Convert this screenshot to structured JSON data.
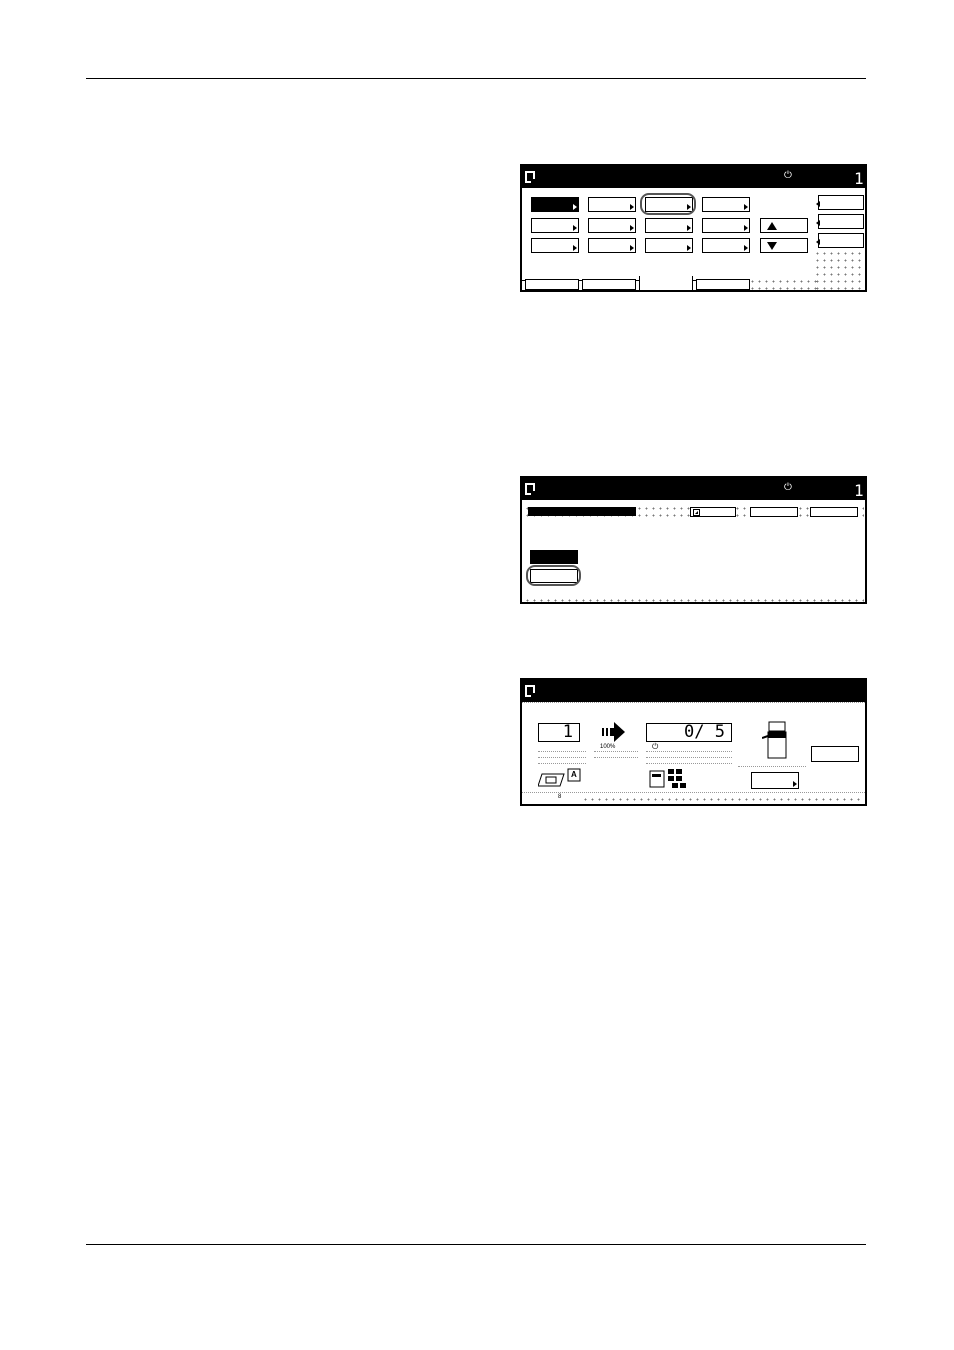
{
  "panel1": {
    "power_glyph": "⏻",
    "copies": "1"
  },
  "panel2": {
    "power_glyph": "⏻",
    "copies": "1"
  },
  "panel3": {
    "original_count": "1",
    "zoom": "100%",
    "progress": "0/ 5",
    "progress_power": "⏻",
    "footer_page": "8",
    "original_label": "A"
  }
}
